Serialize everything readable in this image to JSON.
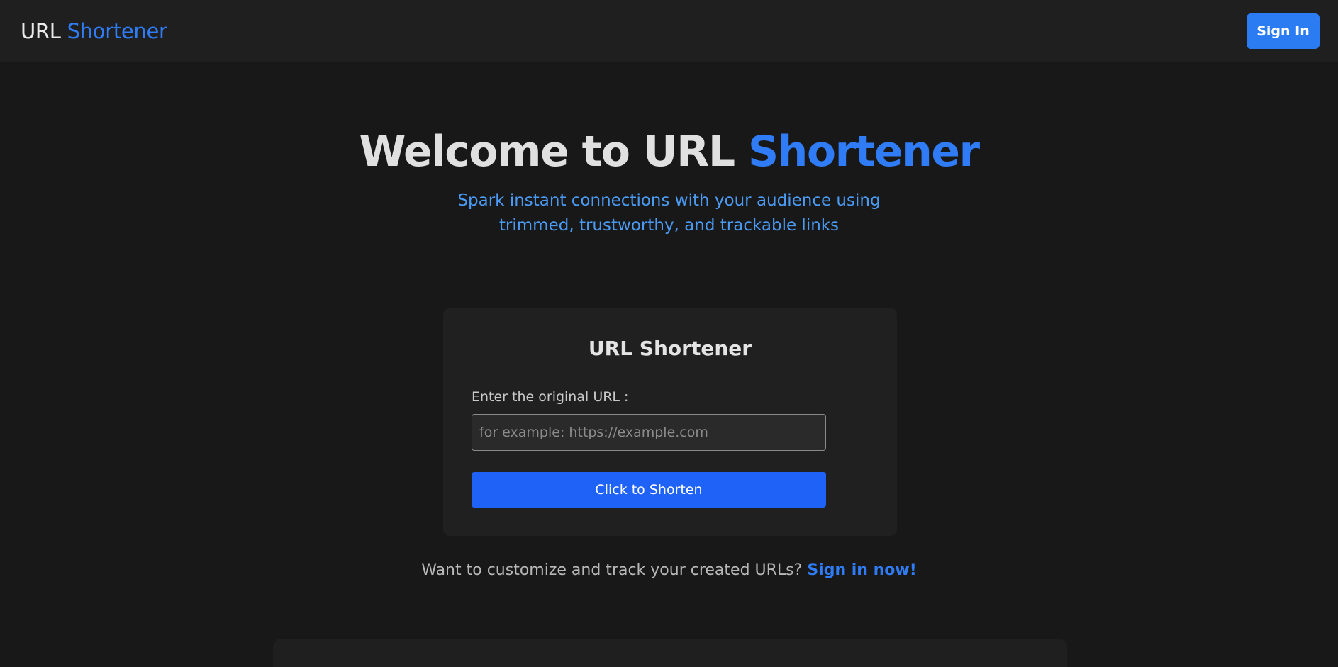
{
  "navbar": {
    "brand_prefix": "URL",
    "brand_accent": "Shortener",
    "signin_label": "Sign In"
  },
  "hero": {
    "title_prefix": "Welcome to URL",
    "title_accent": "Shortener",
    "subtitle_line1": "Spark instant connections with your audience using",
    "subtitle_line2": "trimmed, trustworthy, and trackable links"
  },
  "shortener_card": {
    "title": "URL Shortener",
    "field_label": "Enter the original URL :",
    "input_value": "",
    "input_placeholder": "for example: https://example.com",
    "submit_label": "Click to Shorten"
  },
  "cta": {
    "text": "Want to customize and track your created URLs?",
    "link_label": "Sign in now!"
  },
  "colors": {
    "background": "#181818",
    "surface": "#1f1f1f",
    "accent": "#2f7cf6",
    "button_primary": "#1f62f8",
    "subtitle": "#4b9bf5"
  }
}
